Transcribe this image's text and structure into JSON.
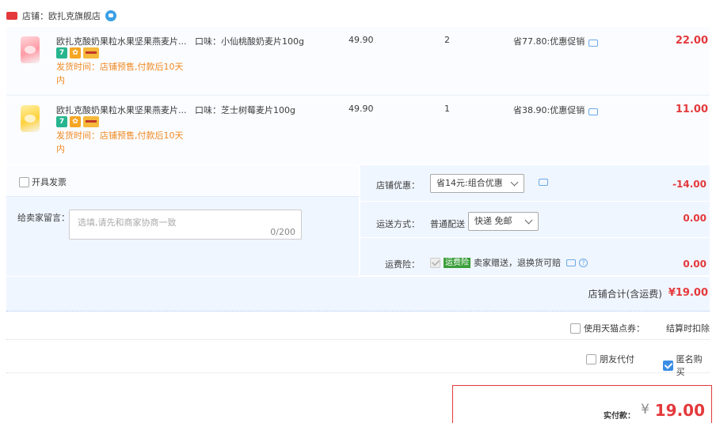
{
  "shop": {
    "label": "店铺：欧扎克旗舰店"
  },
  "items": [
    {
      "title": "欧扎克酸奶果粒水果坚果燕麦片...",
      "badge_seven": "7",
      "shipping": "发货时间：店铺预售,付款后10天内",
      "spec": "口味：小仙桃酸奶麦片100g",
      "price": "49.90",
      "qty": "2",
      "promo": "省77.80:优惠促销",
      "subtotal": "22.00"
    },
    {
      "title": "欧扎克酸奶果粒水果坚果燕麦片...",
      "badge_seven": "7",
      "shipping": "发货时间：店铺预售,付款后10天内",
      "spec": "口味：芝士树莓麦片100g",
      "price": "49.90",
      "qty": "1",
      "promo": "省38.90:优惠促销",
      "subtotal": "11.00"
    }
  ],
  "invoice": {
    "label": "开具发票"
  },
  "message": {
    "label": "给卖家留言：",
    "placeholder": "选填,请先和商家协商一致",
    "count": "0/200"
  },
  "discount": {
    "label": "店铺优惠：",
    "selected": "省14元:组合优惠",
    "value": "-14.00"
  },
  "shipping_method": {
    "label": "运送方式：",
    "text": "普通配送",
    "selected": "快递 免邮",
    "value": "0.00"
  },
  "insurance": {
    "label": "运费险：",
    "tag": "运费险",
    "text": "卖家赠送，退换货可赔",
    "value": "0.00"
  },
  "shop_total": {
    "label": "店铺合计(含运费)",
    "value": "¥19.00"
  },
  "tmall_points": {
    "label": "使用天猫点券：",
    "note": "结算时扣除"
  },
  "friend_pay": {
    "label": "朋友代付"
  },
  "anonymous": {
    "label": "匿名购买"
  },
  "pay": {
    "label": "实付款：",
    "currency": "¥",
    "value": "19.00"
  },
  "colors": {
    "accent": "#e4393c",
    "panel": "#f0f6ff",
    "link": "#3a8ee6",
    "ship": "#f08a24"
  }
}
